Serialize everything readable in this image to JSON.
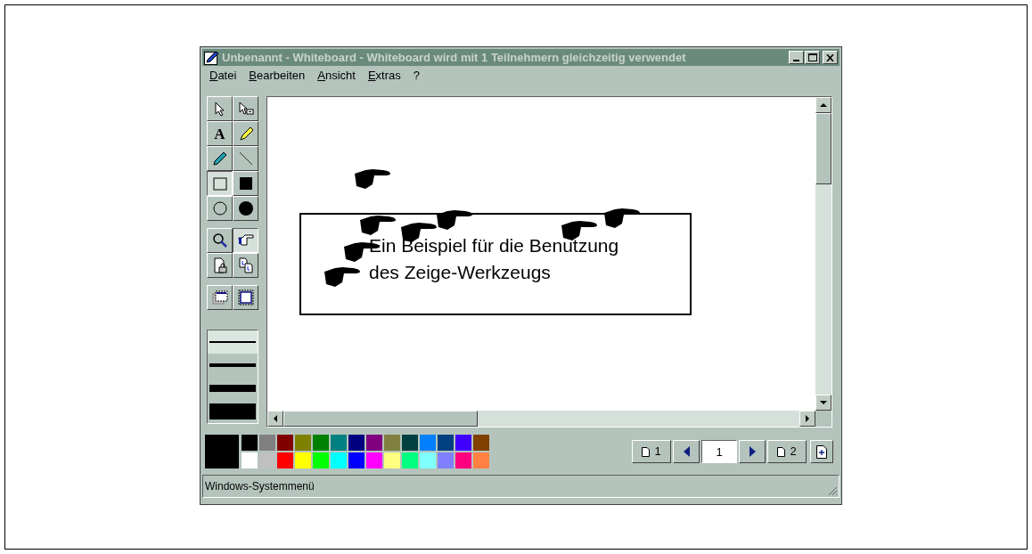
{
  "window": {
    "title": "Unbenannt - Whiteboard - Whiteboard wird mit 1 Teilnehmern gleichzeitig verwendet"
  },
  "menu": [
    {
      "label": "Datei"
    },
    {
      "label": "Bearbeiten"
    },
    {
      "label": "Ansicht"
    },
    {
      "label": "Extras"
    },
    {
      "label": "?"
    }
  ],
  "tools": [
    {
      "kind": "select",
      "selected": false
    },
    {
      "kind": "eraser-select",
      "selected": false
    },
    {
      "kind": "text",
      "glyph": "A",
      "selected": false
    },
    {
      "kind": "highlighter",
      "selected": false
    },
    {
      "kind": "pen",
      "selected": false
    },
    {
      "kind": "line",
      "selected": false
    },
    {
      "kind": "rect",
      "selected": true
    },
    {
      "kind": "filled-rect",
      "selected": false
    },
    {
      "kind": "ellipse",
      "selected": false
    },
    {
      "kind": "filled-ellipse",
      "selected": false
    },
    {
      "kind": "zoom",
      "selected": false
    },
    {
      "kind": "pointer",
      "selected": true
    },
    {
      "kind": "lock",
      "selected": false
    },
    {
      "kind": "sync",
      "selected": false
    },
    {
      "kind": "select-window",
      "selected": false
    },
    {
      "kind": "select-area",
      "selected": false
    }
  ],
  "line_widths": [
    {
      "selected": true
    },
    {
      "selected": false
    },
    {
      "selected": false
    },
    {
      "selected": false
    }
  ],
  "canvas": {
    "text_lines": [
      "Ein Beispiel für die Benutzung",
      "des Zeige-Werkzeugs"
    ]
  },
  "current_color": {
    "color": "#000000"
  },
  "palette": [
    {
      "color": "#000000"
    },
    {
      "color": "#808080"
    },
    {
      "color": "#800000"
    },
    {
      "color": "#808000"
    },
    {
      "color": "#008000"
    },
    {
      "color": "#008080"
    },
    {
      "color": "#000080"
    },
    {
      "color": "#800080"
    },
    {
      "color": "#808040"
    },
    {
      "color": "#004040"
    },
    {
      "color": "#0080ff"
    },
    {
      "color": "#004080"
    },
    {
      "color": "#4000ff"
    },
    {
      "color": "#804000"
    },
    {
      "color": "#ffffff"
    },
    {
      "color": "#c0c0c0"
    },
    {
      "color": "#ff0000"
    },
    {
      "color": "#ffff00"
    },
    {
      "color": "#00ff00"
    },
    {
      "color": "#00ffff"
    },
    {
      "color": "#0000ff"
    },
    {
      "color": "#ff00ff"
    },
    {
      "color": "#ffff80"
    },
    {
      "color": "#00ff80"
    },
    {
      "color": "#80ffff"
    },
    {
      "color": "#8080ff"
    },
    {
      "color": "#ff0080"
    },
    {
      "color": "#ff8040"
    }
  ],
  "pages": {
    "prev_page": "1",
    "current_page": "1",
    "next_page": "2"
  },
  "status_bar": {
    "text": "Windows-Systemmenü"
  }
}
